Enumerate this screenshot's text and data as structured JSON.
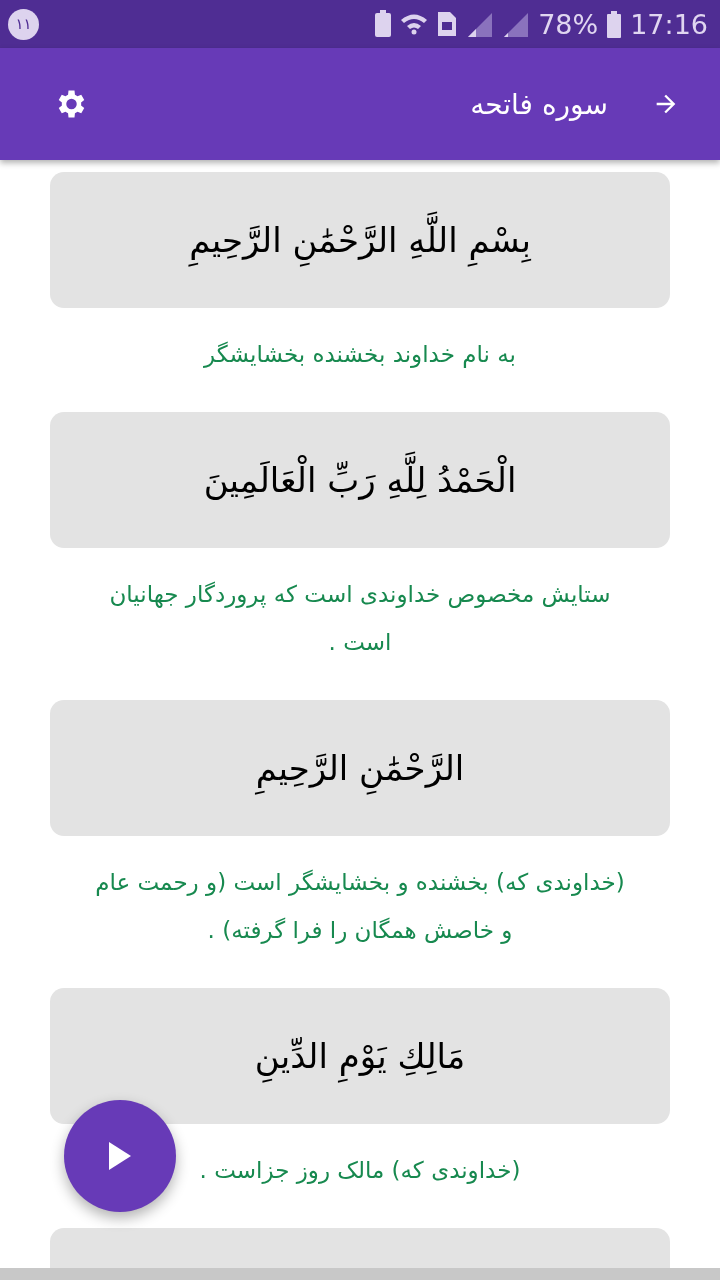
{
  "status_bar": {
    "notification_count": "۱۱",
    "battery": "78%",
    "time": "17:16"
  },
  "app_bar": {
    "title": "سوره فاتحه"
  },
  "verses": [
    {
      "arabic": "بِسْمِ اللَّهِ الرَّحْمَٰنِ الرَّحِيمِ",
      "translation": "به نام خداوند بخشنده بخشایشگر"
    },
    {
      "arabic": "الْحَمْدُ لِلَّهِ رَبِّ الْعَالَمِينَ",
      "translation": "ستایش مخصوص خداوندی است که پروردگار جهانیان است ."
    },
    {
      "arabic": "الرَّحْمَٰنِ الرَّحِيمِ",
      "translation": "(خداوندی که) بخشنده و بخشایشگر است (و رحمت عام و خاصش همگان را فرا گرفته) ."
    },
    {
      "arabic": "مَالِكِ يَوْمِ الدِّينِ",
      "translation": "(خداوندی که) مالک روز جزاست ."
    }
  ]
}
